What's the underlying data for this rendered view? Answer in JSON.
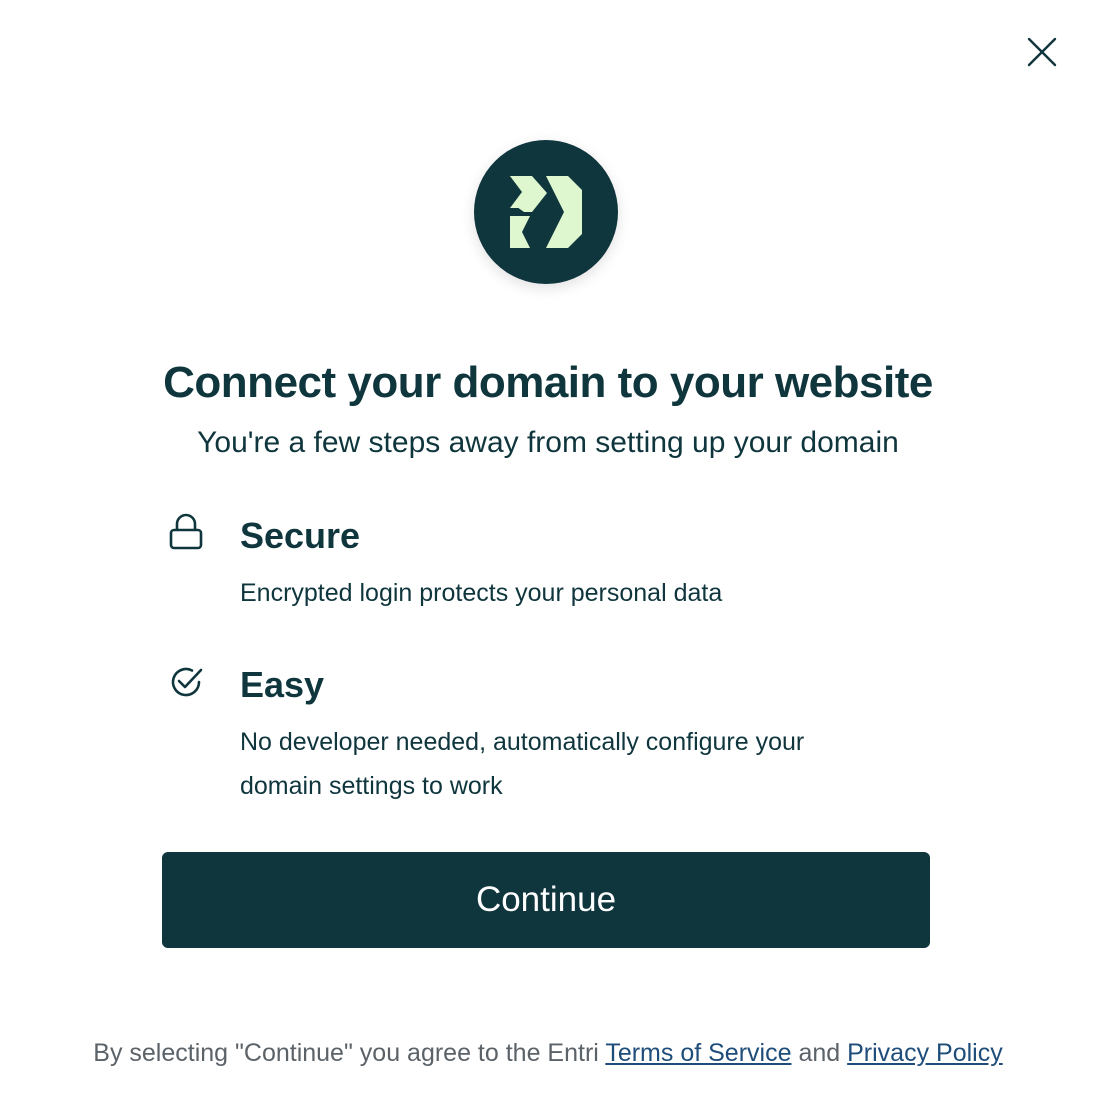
{
  "modal": {
    "close_icon": "close-icon",
    "logo_icon": "entri-logo",
    "title": "Connect your domain to your website",
    "subtitle": "You're a few steps away from setting up your domain"
  },
  "features": [
    {
      "icon": "lock-icon",
      "title": "Secure",
      "description": "Encrypted login protects your personal data"
    },
    {
      "icon": "check-circle-icon",
      "title": "Easy",
      "description": "No developer needed, automatically configure your domain settings to work"
    }
  ],
  "continue_button": {
    "label": "Continue"
  },
  "footer": {
    "prefix": "By selecting \"Continue\" you agree to the Entri",
    "terms_link": "Terms of Service",
    "conjunction": "and",
    "privacy_link": "Privacy Policy"
  },
  "colors": {
    "primary": "#0f353d",
    "logo_mark": "#dff7cf",
    "footer_text": "#5b6268",
    "link": "#1f4d7a"
  }
}
